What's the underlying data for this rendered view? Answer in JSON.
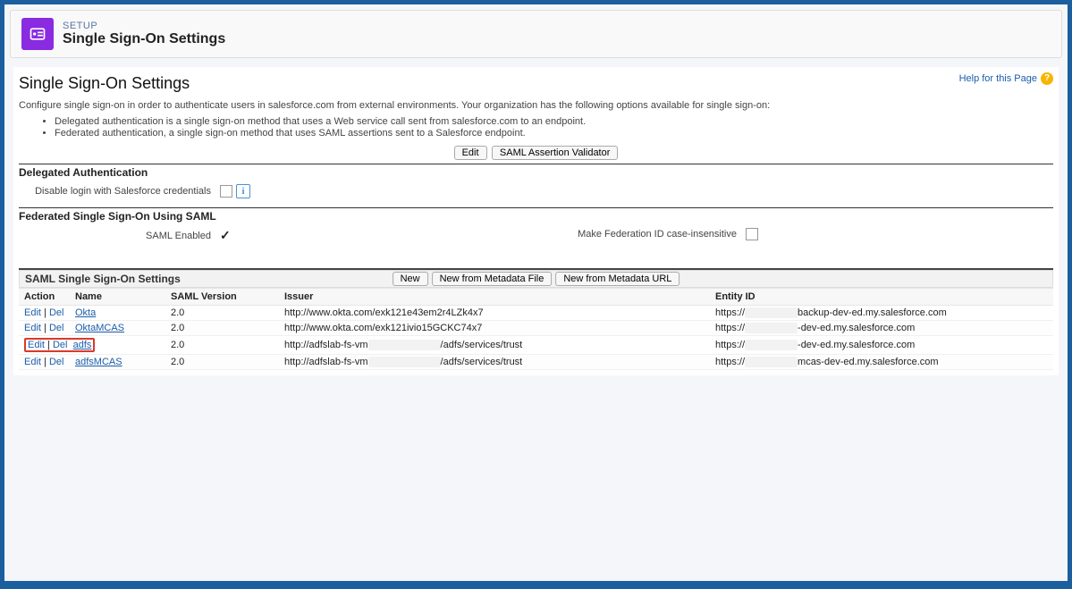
{
  "header": {
    "eyebrow": "SETUP",
    "title": "Single Sign-On Settings"
  },
  "help_link_label": "Help for this Page",
  "page_title": "Single Sign-On Settings",
  "description": "Configure single sign-on in order to authenticate users in salesforce.com from external environments. Your organization has the following options available for single sign-on:",
  "bullets": [
    "Delegated authentication is a single sign-on method that uses a Web service call sent from salesforce.com to an endpoint.",
    "Federated authentication, a single sign-on method that uses SAML assertions sent to a Salesforce endpoint."
  ],
  "top_buttons": {
    "edit": "Edit",
    "validator": "SAML Assertion Validator"
  },
  "sections": {
    "delegated_title": "Delegated Authentication",
    "disable_login_label": "Disable login with Salesforce credentials",
    "federated_title": "Federated Single Sign-On Using SAML",
    "saml_enabled_label": "SAML Enabled",
    "federation_case_label": "Make Federation ID case-insensitive"
  },
  "saml_panel": {
    "title": "SAML Single Sign-On Settings",
    "buttons": {
      "new": "New",
      "new_file": "New from Metadata File",
      "new_url": "New from Metadata URL"
    },
    "columns": {
      "action": "Action",
      "name": "Name",
      "saml_version": "SAML Version",
      "issuer": "Issuer",
      "entity_id": "Entity ID"
    },
    "action_labels": {
      "edit": "Edit",
      "del": "Del"
    },
    "rows": [
      {
        "name": "Okta",
        "version": "2.0",
        "issuer_pre": "http://www.okta.com/exk121e43em2r4LZk4x7",
        "issuer_mask": "",
        "issuer_post": "",
        "entity_pre": "https://",
        "entity_mask": "xxxxxxxxxx",
        "entity_post": "backup-dev-ed.my.salesforce.com",
        "highlight": false
      },
      {
        "name": "OktaMCAS",
        "version": "2.0",
        "issuer_pre": "http://www.okta.com/exk121ivio15GCKC74x7",
        "issuer_mask": "",
        "issuer_post": "",
        "entity_pre": "https://",
        "entity_mask": "xxxxxxxxxx",
        "entity_post": "-dev-ed.my.salesforce.com",
        "highlight": false
      },
      {
        "name": "adfs",
        "version": "2.0",
        "issuer_pre": "http://adfslab-fs-vm",
        "issuer_mask": "xxxxxxxxxxxxxx",
        "issuer_post": "/adfs/services/trust",
        "entity_pre": "https://",
        "entity_mask": "xxxxxxxxxx",
        "entity_post": "-dev-ed.my.salesforce.com",
        "highlight": true
      },
      {
        "name": "adfsMCAS",
        "version": "2.0",
        "issuer_pre": "http://adfslab-fs-vm",
        "issuer_mask": "xxxxxxxxxxxxxx",
        "issuer_post": "/adfs/services/trust",
        "entity_pre": "https://",
        "entity_mask": "xxxxxxxxxx",
        "entity_post": "mcas-dev-ed.my.salesforce.com",
        "highlight": false
      }
    ]
  }
}
